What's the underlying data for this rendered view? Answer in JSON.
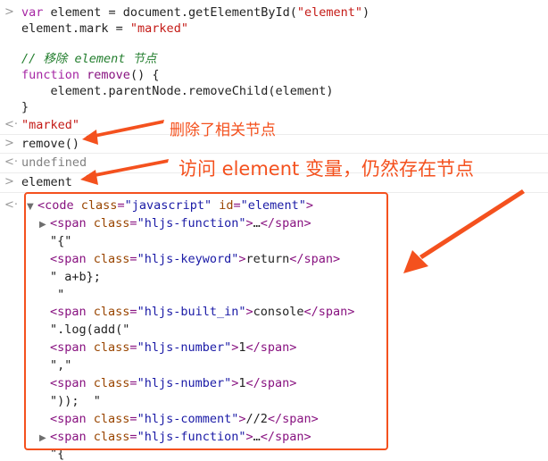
{
  "console": {
    "code_block": {
      "line1_kw": "var",
      "line1_rest": " element = document.getElementById(",
      "line1_str": "\"element\"",
      "line1_end": ")",
      "line2_rest": "element.mark = ",
      "line2_str": "\"marked\"",
      "line3_comment": "// 移除 element 节点",
      "line4_kw": "function",
      "line4_fn": " remove",
      "line4_rest": "() {",
      "line5": "    element.parentNode.removeChild(element)",
      "line6": "}"
    },
    "result_marked": "\"marked\"",
    "cmd_remove": "remove()",
    "result_undefined": "undefined",
    "cmd_element": "element",
    "dom_tree": {
      "root_open": "<",
      "root_tag": "code",
      "root_attr1": "class",
      "root_val1": "\"javascript\"",
      "root_attr2": "id",
      "root_val2": "\"element\"",
      "root_close": ">",
      "nodes": [
        {
          "kind": "collapsed",
          "cls": "\"hljs-function\"",
          "text": "…"
        },
        {
          "kind": "text",
          "text": "\"{\""
        },
        {
          "kind": "span",
          "cls": "\"hljs-keyword\"",
          "text": "return"
        },
        {
          "kind": "text",
          "text": "\" a+b};"
        },
        {
          "kind": "text",
          "text": " \""
        },
        {
          "kind": "span",
          "cls": "\"hljs-built_in\"",
          "text": "console"
        },
        {
          "kind": "text",
          "text": "\".log(add(\""
        },
        {
          "kind": "span",
          "cls": "\"hljs-number\"",
          "text": "1"
        },
        {
          "kind": "text",
          "text": "\",\""
        },
        {
          "kind": "span",
          "cls": "\"hljs-number\"",
          "text": "1"
        },
        {
          "kind": "text",
          "text": "\"));  \""
        },
        {
          "kind": "span",
          "cls": "\"hljs-comment\"",
          "text": "//2"
        },
        {
          "kind": "collapsed",
          "cls": "\"hljs-function\"",
          "text": "…"
        },
        {
          "kind": "text",
          "text": "\"{"
        }
      ],
      "span_tag": "span",
      "class_attr": "class"
    }
  },
  "annotations": {
    "removed_note": "删除了相关节点",
    "access_note": "访问 element 变量，仍然存在节点"
  },
  "colors": {
    "annotation": "#f4511e",
    "tag": "#881280",
    "attr": "#994500",
    "attr_value": "#1a1aa6",
    "string": "#c41a16",
    "comment": "#237e2e"
  }
}
